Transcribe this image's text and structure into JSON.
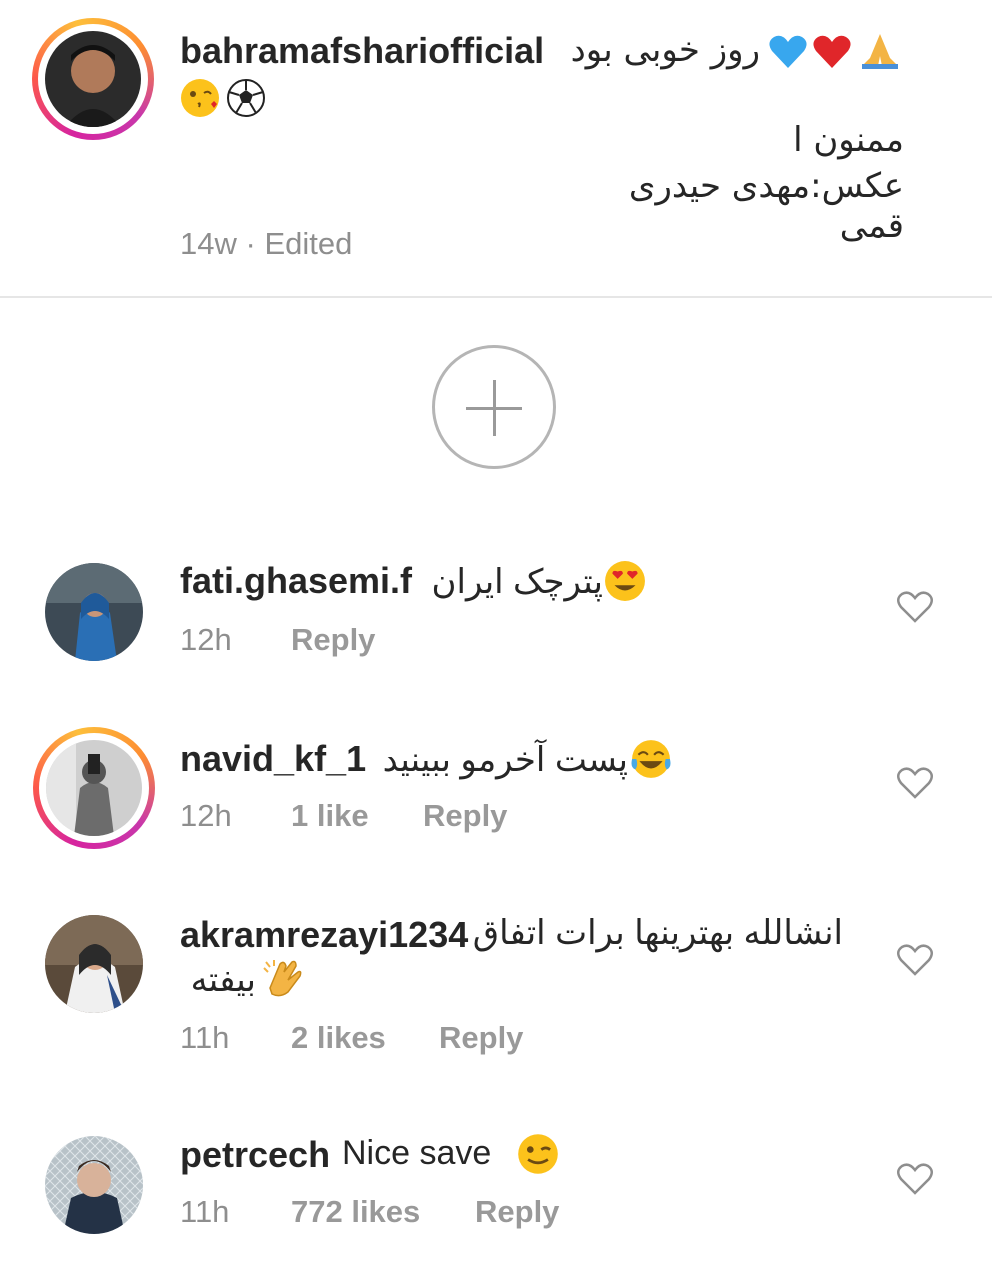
{
  "post": {
    "username": "bahramafsharіofficial",
    "caption_line1": "روز خوبی بود",
    "caption_line2": "ممنون ا",
    "caption_line3": "عکس:مهدی حیدری قمی",
    "time": "14w",
    "separator": "·",
    "edited": "Edited"
  },
  "comments": [
    {
      "username": "fati.ghasemi.f",
      "text": "پترچک ایران",
      "time": "12h",
      "likes": "",
      "reply": "Reply",
      "story_ring": false
    },
    {
      "username": "navid_kf_1",
      "text": "پست آخرمو ببینید",
      "time": "12h",
      "likes": "1 like",
      "reply": "Reply",
      "story_ring": true
    },
    {
      "username": "akramrezayi1234",
      "text": "انشالله بهترینها برات اتفاق",
      "text2": "بیفته",
      "time": "11h",
      "likes": "2 likes",
      "reply": "Reply",
      "story_ring": false
    },
    {
      "username": "petrcech",
      "text": "Nice save",
      "time": "11h",
      "likes": "772 likes",
      "reply": "Reply",
      "story_ring": false
    }
  ],
  "icons": {
    "load_more": "plus-circle-icon",
    "like": "heart-outline-icon"
  },
  "colors": {
    "text": "#262626",
    "meta": "#8e8e8e",
    "ring_start": "#d6249f",
    "ring_end": "#fdbf3b"
  }
}
